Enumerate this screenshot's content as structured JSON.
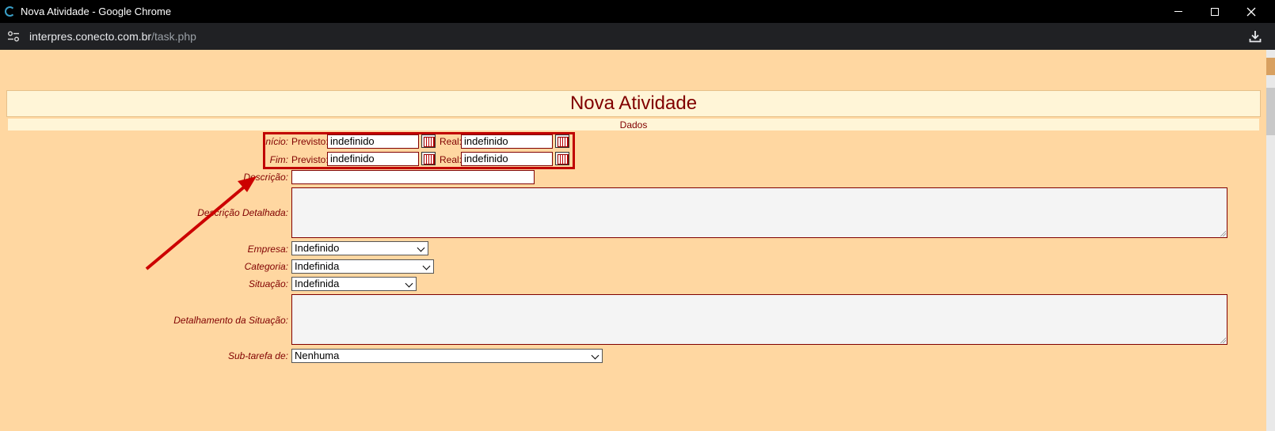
{
  "window": {
    "title": "Nova Atividade - Google Chrome",
    "url_host": "interpres.conecto.com.br",
    "url_path": "/task.php"
  },
  "page": {
    "heading": "Nova Atividade",
    "section": "Dados"
  },
  "dates": {
    "inicio_label": "Início:",
    "fim_label": "Fim:",
    "previsto_label": "Previsto:",
    "real_label": "Real:",
    "inicio_previsto": "indefinido",
    "inicio_real": "indefinido",
    "fim_previsto": "indefinido",
    "fim_real": "indefinido"
  },
  "form": {
    "descricao_label": "Descrição:",
    "descricao_value": "",
    "descricao_detalhada_label": "Descrição Detalhada:",
    "empresa_label": "Empresa:",
    "empresa_value": "Indefinido",
    "categoria_label": "Categoria:",
    "categoria_value": "Indefinida",
    "situacao_label": "Situação:",
    "situacao_value": "Indefinida",
    "detalhamento_label": "Detalhamento da Situação:",
    "subtarefa_label": "Sub-tarefa de:",
    "subtarefa_value": "Nenhuma"
  },
  "colors": {
    "page_bg": "#ffd7a1",
    "label": "#800000",
    "highlight": "#c00000"
  }
}
